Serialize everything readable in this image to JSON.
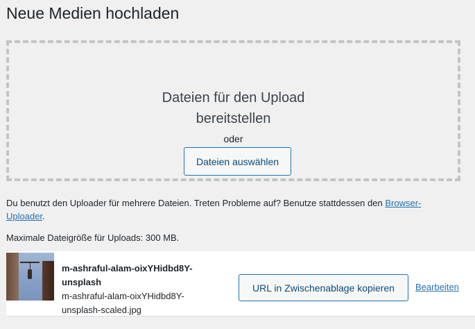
{
  "page": {
    "title": "Neue Medien hochladen"
  },
  "dropzone": {
    "info_line1": "Dateien für den Upload",
    "info_line2": "bereitstellen",
    "or_label": "oder",
    "select_button": "Dateien auswählen"
  },
  "help": {
    "text": "Du benutzt den Uploader für mehrere Dateien. Treten Probleme auf? Benutze stattdessen den ",
    "link_part1": "Browser-",
    "link_part2": "Uploader",
    "text_end": "."
  },
  "max_size": "Maximale Dateigröße für Uploads: 300 MB.",
  "media_item": {
    "title_line1": "m-ashraful-alam-oixYHidbd8Y-",
    "title_line2": "unsplash",
    "file_line1": "m-ashraful-alam-oixYHidbd8Y-",
    "file_line2": "unsplash-scaled.jpg",
    "copy_button": "URL in Zwischenablage kopieren",
    "edit_link": "Bearbeiten"
  }
}
